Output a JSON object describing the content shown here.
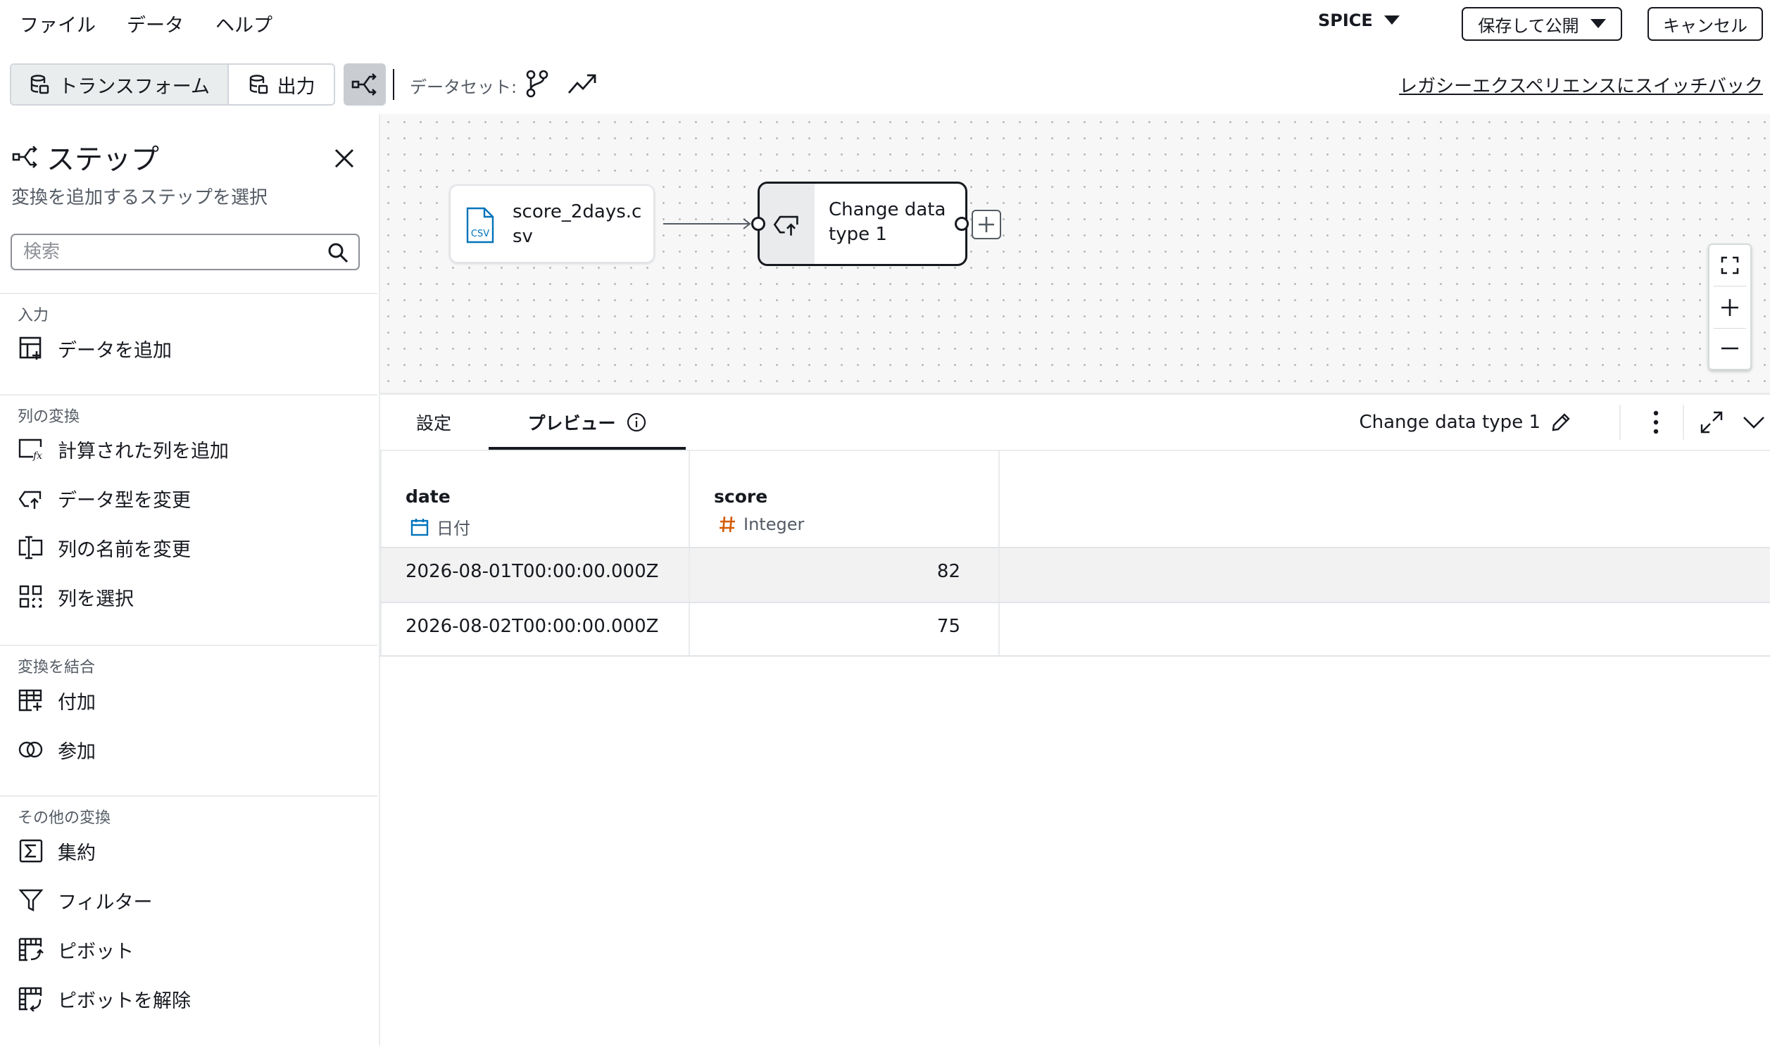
{
  "menu": {
    "file": "ファイル",
    "data": "データ",
    "help": "ヘルプ"
  },
  "header": {
    "spice": "SPICE",
    "save_publish": "保存して公開",
    "cancel": "キャンセル"
  },
  "toolbar": {
    "transform": "トランスフォーム",
    "output": "出力",
    "dataset_label": "データセット:",
    "legacy_link": "レガシーエクスペリエンスにスイッチバック"
  },
  "sidebar": {
    "title": "ステップ",
    "subtitle": "変換を追加するステップを選択",
    "search_placeholder": "検索",
    "sections": {
      "input": "入力",
      "column_transforms": "列の変換",
      "combine_transforms": "変換を結合",
      "other_transforms": "その他の変換"
    },
    "items": {
      "add_data": "データを追加",
      "add_calculated_column": "計算された列を追加",
      "change_data_type": "データ型を変更",
      "rename_column": "列の名前を変更",
      "select_columns": "列を選択",
      "append": "付加",
      "join": "参加",
      "aggregate": "集約",
      "filter": "フィルター",
      "pivot": "ピボット",
      "unpivot": "ピボットを解除"
    }
  },
  "canvas": {
    "source_node": {
      "label": "score_2days.csv",
      "badge": "CSV"
    },
    "step_node": {
      "label": "Change data type 1"
    }
  },
  "panel": {
    "tabs": {
      "settings": "設定",
      "preview": "プレビュー"
    },
    "step_name": "Change data type 1",
    "columns": [
      {
        "name": "date",
        "type": "日付",
        "type_color": "#0073bb"
      },
      {
        "name": "score",
        "type": "Integer",
        "type_color": "#d45b07"
      }
    ],
    "rows": [
      {
        "date": "2026-08-01T00:00:00.000Z",
        "score": "82"
      },
      {
        "date": "2026-08-02T00:00:00.000Z",
        "score": "75"
      }
    ]
  },
  "colors": {
    "accent": "#16191f",
    "selected_tab_bg": "#eaeded",
    "canvas_bg": "#f7f7f7"
  }
}
